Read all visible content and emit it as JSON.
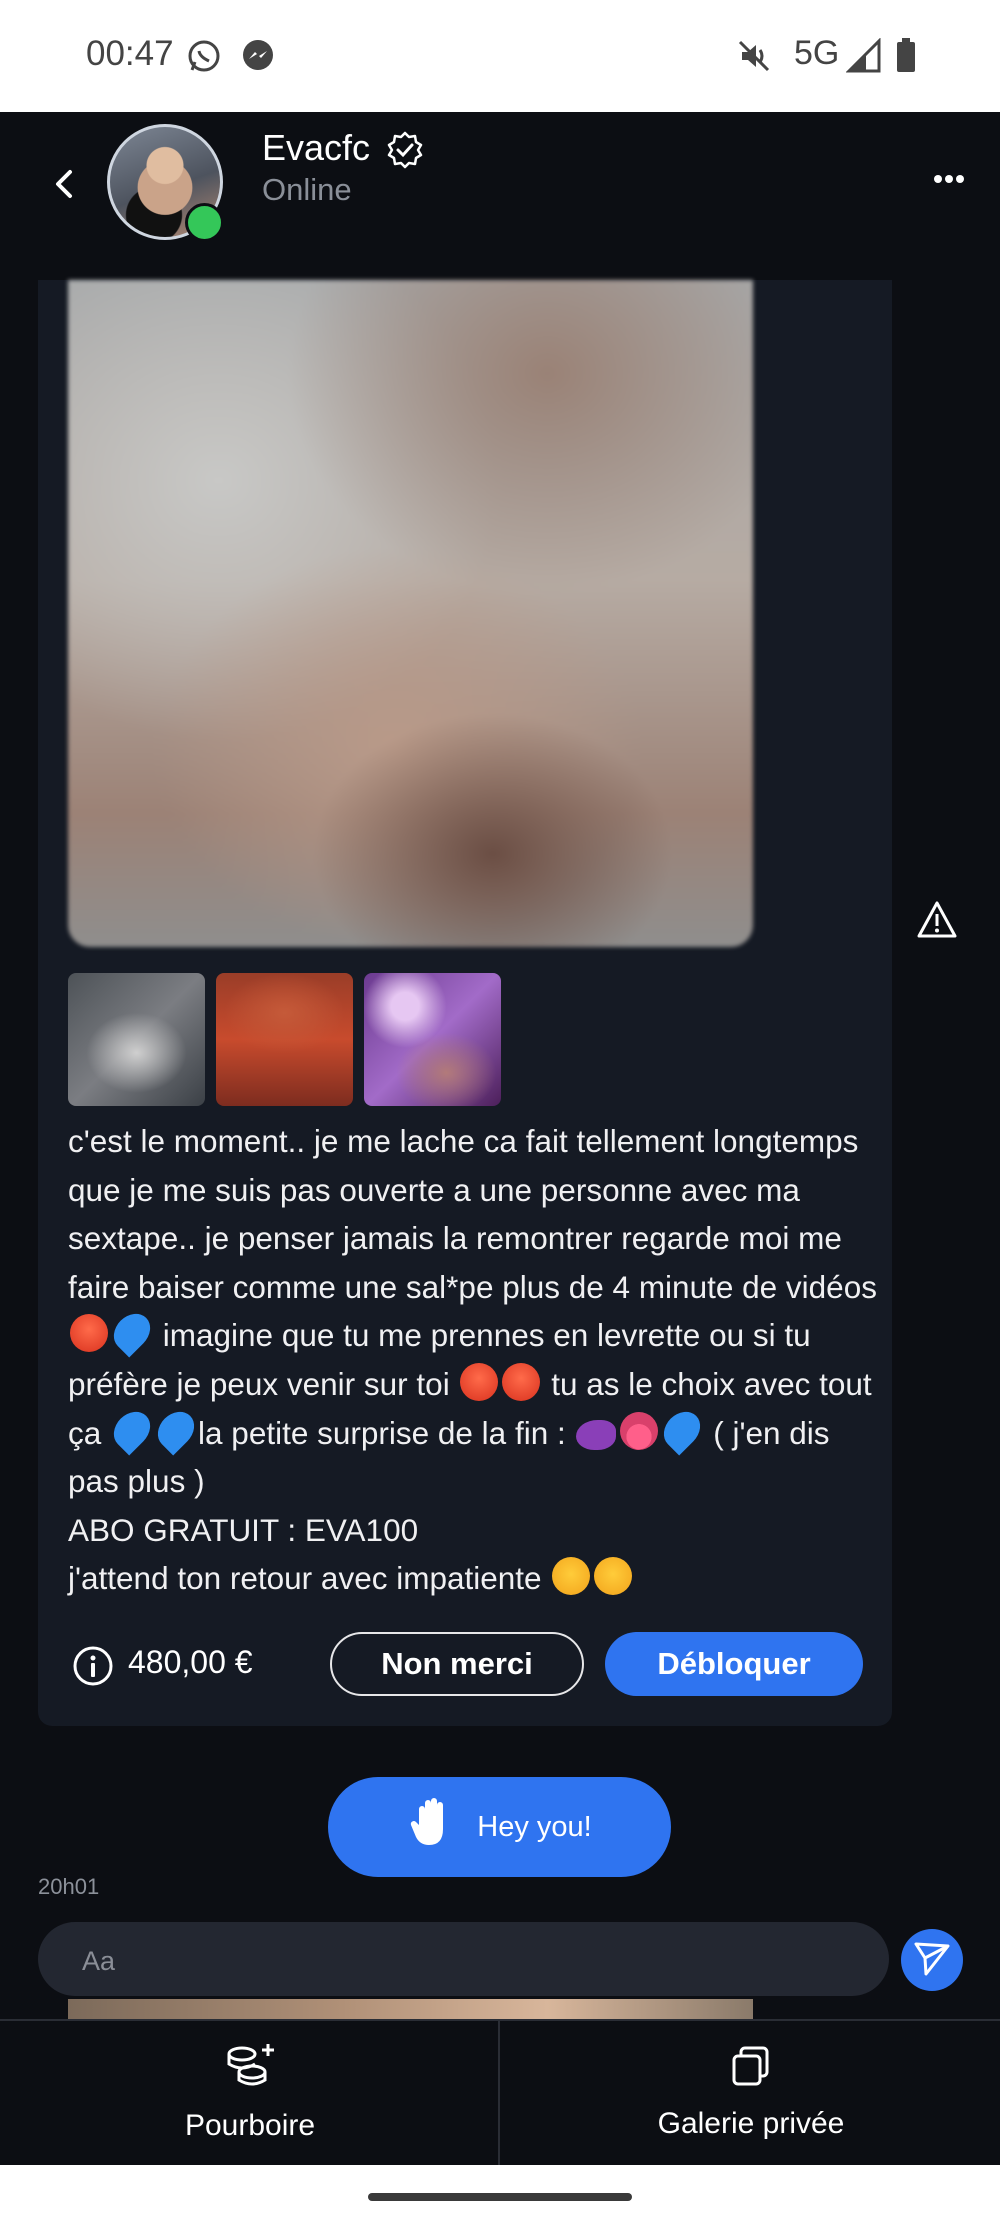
{
  "status_bar": {
    "time": "00:47",
    "network": "5G"
  },
  "header": {
    "name": "Evacfc",
    "presence": "Online"
  },
  "message": {
    "paragraphs": [
      [
        "c'est le moment.. je me lache ca fait tellement longtemps que je me suis pas ouverte a une personne avec ma sextape.. je penser jamais la remontrer regarde moi me faire baiser comme une sal*pe plus de 4 minute de vidéos ",
        {
          "e": "hot"
        },
        {
          "e": "drop"
        },
        " imagine que tu me prennes en levrette ou si tu préfère je peux venir sur toi ",
        {
          "e": "hot"
        },
        {
          "e": "hot"
        },
        " tu as le choix avec tout ça ",
        {
          "e": "drop"
        },
        {
          "e": "drop"
        },
        "la petite surprise de la fin : ",
        {
          "e": "eggplant"
        },
        {
          "e": "tongue"
        },
        {
          "e": "drop"
        },
        " ( j'en dis pas plus )"
      ],
      [
        "ABO GRATUIT : EVA100"
      ],
      [
        "j'attend ton retour avec impatiente ",
        {
          "e": "love"
        },
        {
          "e": "love"
        }
      ]
    ],
    "price": "480,00 €",
    "decline_label": "Non merci",
    "unlock_label": "Débloquer"
  },
  "quick_reply": {
    "label": "Hey you!"
  },
  "timestamp": "20h01",
  "composer": {
    "placeholder": "Aa"
  },
  "bottom_tabs": {
    "tip_label": "Pourboire",
    "gallery_label": "Galerie privée"
  },
  "colors": {
    "accent": "#2f74f0",
    "online": "#34c759",
    "background": "#0c0e13",
    "card": "#151a24"
  }
}
